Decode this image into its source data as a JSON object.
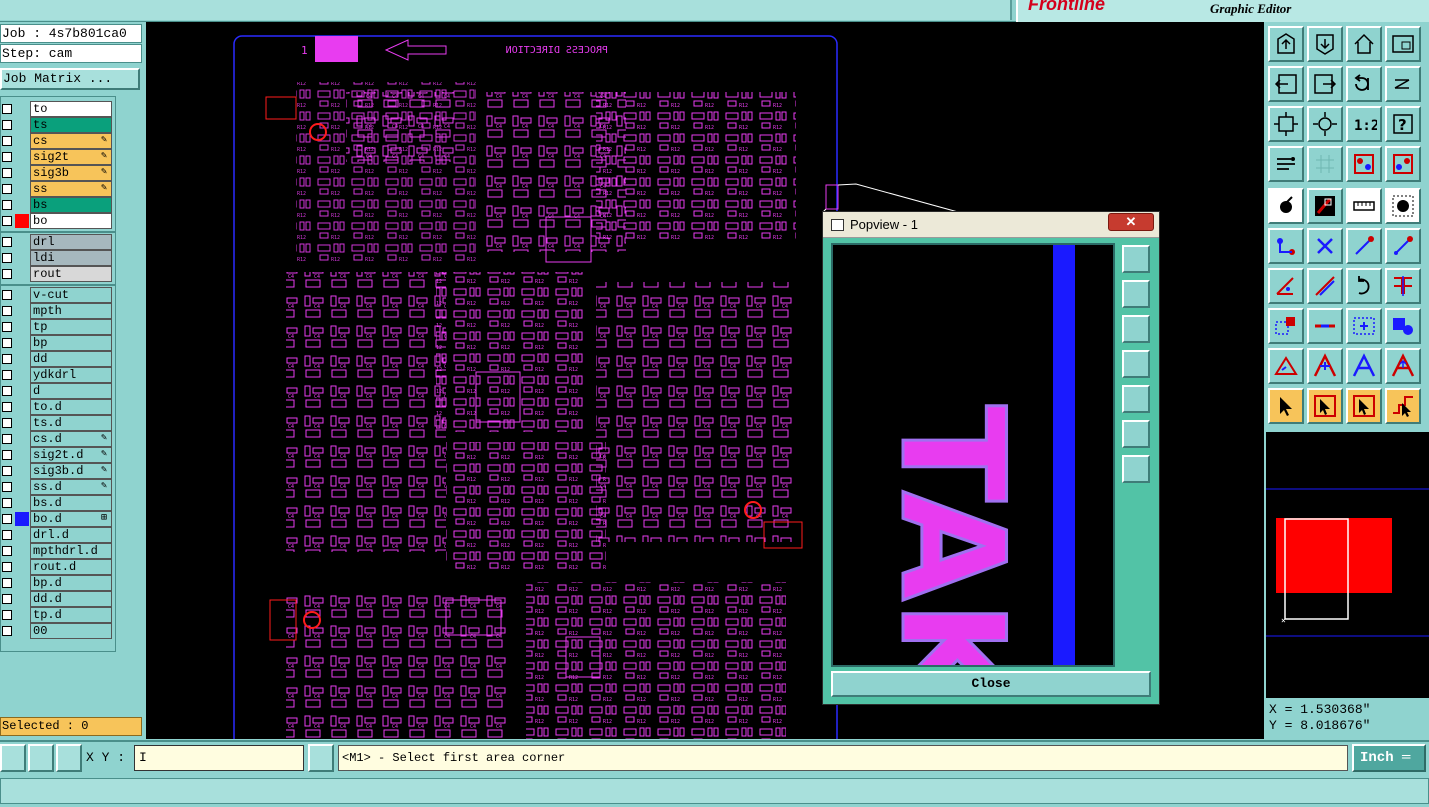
{
  "app": {
    "brand": "Frontline",
    "subtitle": "Graphic Editor"
  },
  "job": {
    "job_line": "Job : 4s7b801ca0",
    "step_line": "Step: cam",
    "matrix_button": "Job Matrix ..."
  },
  "layers": [
    {
      "name": "to",
      "color": "#ffffff",
      "mark": ""
    },
    {
      "name": "ts",
      "color": "#0aa07c",
      "mark": ""
    },
    {
      "name": "cs",
      "color": "#f7c45a",
      "mark": "✎"
    },
    {
      "name": "sig2t",
      "color": "#f7c45a",
      "mark": "✎"
    },
    {
      "name": "sig3b",
      "color": "#f7c45a",
      "mark": "✎"
    },
    {
      "name": "ss",
      "color": "#f7c45a",
      "mark": "✎"
    },
    {
      "name": "bs",
      "color": "#0aa07c",
      "mark": ""
    },
    {
      "name": "bo",
      "color": "#ffffff",
      "mark": "",
      "swatch": "#ff0000"
    },
    {
      "name": "drl",
      "color": "#a6b8be",
      "mark": ""
    },
    {
      "name": "ldi",
      "color": "#a6b8be",
      "mark": ""
    },
    {
      "name": "rout",
      "color": "#d8d8d8",
      "mark": ""
    },
    {
      "name": "v-cut",
      "color": "#8fd3cf",
      "mark": ""
    },
    {
      "name": "mpth",
      "color": "#8fd3cf",
      "mark": ""
    },
    {
      "name": "tp",
      "color": "#8fd3cf",
      "mark": ""
    },
    {
      "name": "bp",
      "color": "#8fd3cf",
      "mark": ""
    },
    {
      "name": "dd",
      "color": "#8fd3cf",
      "mark": ""
    },
    {
      "name": "ydkdrl",
      "color": "#8fd3cf",
      "mark": ""
    },
    {
      "name": "d",
      "color": "#8fd3cf",
      "mark": ""
    },
    {
      "name": "to.d",
      "color": "#8fd3cf",
      "mark": ""
    },
    {
      "name": "ts.d",
      "color": "#8fd3cf",
      "mark": ""
    },
    {
      "name": "cs.d",
      "color": "#8fd3cf",
      "mark": "✎"
    },
    {
      "name": "sig2t.d",
      "color": "#8fd3cf",
      "mark": "✎"
    },
    {
      "name": "sig3b.d",
      "color": "#8fd3cf",
      "mark": "✎"
    },
    {
      "name": "ss.d",
      "color": "#8fd3cf",
      "mark": "✎"
    },
    {
      "name": "bs.d",
      "color": "#8fd3cf",
      "mark": ""
    },
    {
      "name": "bo.d",
      "color": "#8fd3cf",
      "mark": "⊞",
      "swatch": "#1a1aff"
    },
    {
      "name": "drl.d",
      "color": "#8fd3cf",
      "mark": ""
    },
    {
      "name": "mpthdrl.d",
      "color": "#8fd3cf",
      "mark": ""
    },
    {
      "name": "rout.d",
      "color": "#8fd3cf",
      "mark": ""
    },
    {
      "name": "bp.d",
      "color": "#8fd3cf",
      "mark": ""
    },
    {
      "name": "dd.d",
      "color": "#8fd3cf",
      "mark": ""
    },
    {
      "name": "tp.d",
      "color": "#8fd3cf",
      "mark": ""
    },
    {
      "name": "00",
      "color": "#8fd3cf",
      "mark": ""
    }
  ],
  "selected_label": "Selected : 0",
  "canvas": {
    "direction_text": "PROCESS DIRECTION",
    "small_marker": "1",
    "board_color": "#e83cf0",
    "outline_color": "#2a2aff",
    "accent_red": "#ff1c1c"
  },
  "popview": {
    "title": "Popview - 1",
    "close_x": "✕",
    "close_button": "Close",
    "zoom_text": "TAK"
  },
  "right_tools": {
    "rows": [
      [
        "pan-up-icon",
        "pan-down-icon",
        "home-icon",
        "zoom-window-icon"
      ],
      [
        "pan-left-icon",
        "pan-right-icon",
        "redo-icon",
        "refresh-icon"
      ],
      [
        "fit-icon",
        "zoom-in-icon",
        "scale-icon",
        "help-icon"
      ],
      [
        "tools-icon",
        "grid-icon",
        "snap-icon",
        "snap2-icon"
      ],
      [
        "pad-icon",
        "flash-icon",
        "measure-icon",
        "circle-icon"
      ],
      [
        "move-icon",
        "cross-icon",
        "line-icon",
        "arc-icon"
      ],
      [
        "edit-icon",
        "slash-icon",
        "rotate-icon",
        "mirror-icon"
      ],
      [
        "select-area-icon",
        "minus-icon",
        "copy-icon",
        "group-icon"
      ],
      [
        "triangle-icon",
        "triangle2-icon",
        "a-icon",
        "a2-icon"
      ],
      [
        "pointer-icon",
        "pointer2-icon",
        "pointer3-icon",
        "pointer4-icon"
      ]
    ]
  },
  "coords": {
    "x": "X = 1.530368\"",
    "y": "Y = 8.018676\""
  },
  "bottom": {
    "xy_label": "X Y :",
    "xy_value": "I",
    "message": "<M1> - Select first area corner",
    "unit": "Inch ═"
  }
}
